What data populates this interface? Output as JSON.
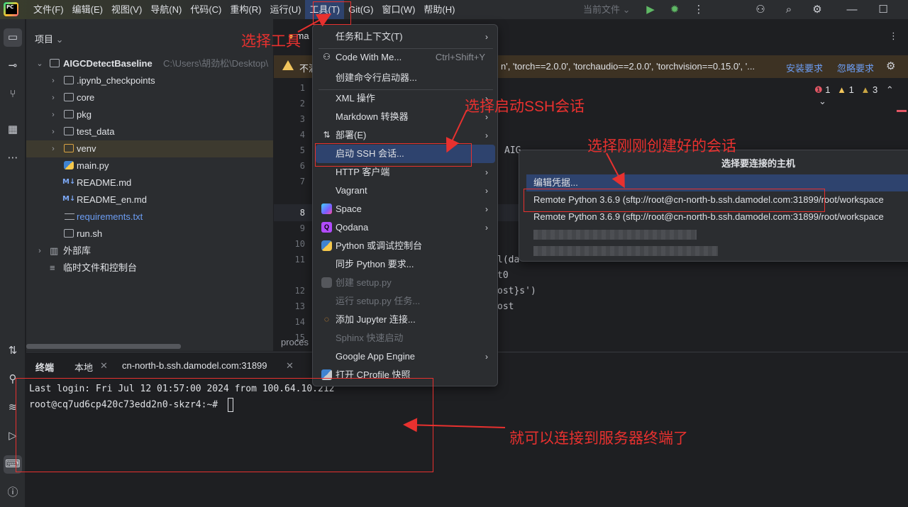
{
  "menubar": {
    "items": [
      {
        "label": "文件(F)"
      },
      {
        "label": "编辑(E)"
      },
      {
        "label": "视图(V)"
      },
      {
        "label": "导航(N)"
      },
      {
        "label": "代码(C)"
      },
      {
        "label": "重构(R)"
      },
      {
        "label": "运行(U)"
      },
      {
        "label": "工具(T)"
      },
      {
        "label": "Git(G)"
      },
      {
        "label": "窗口(W)"
      },
      {
        "label": "帮助(H)"
      }
    ],
    "run_config": "当前文件"
  },
  "project_panel": {
    "title": "项目",
    "root": {
      "name": "AIGCDetectBaseline",
      "path": "C:\\Users\\胡劲松\\Desktop\\"
    },
    "items": [
      {
        "name": ".ipynb_checkpoints",
        "type": "folder"
      },
      {
        "name": "core",
        "type": "folder"
      },
      {
        "name": "pkg",
        "type": "folder"
      },
      {
        "name": "test_data",
        "type": "folder"
      },
      {
        "name": "venv",
        "type": "folder"
      },
      {
        "name": "main.py",
        "type": "python"
      },
      {
        "name": "README.md",
        "type": "markdown"
      },
      {
        "name": "README_en.md",
        "type": "markdown"
      },
      {
        "name": "requirements.txt",
        "type": "text"
      },
      {
        "name": "run.sh",
        "type": "shell"
      }
    ],
    "external_libs": "外部库",
    "scratches": "临时文件和控制台"
  },
  "editor": {
    "tab_partial": "ma",
    "banner": {
      "text_left": "不满",
      "text_right": "n', 'torch==2.0.0', 'torchaudio==2.0.0', 'torchvision==0.15.0', '...",
      "install_link": "安装要求",
      "ignore_link": "忽略要求"
    },
    "inspections": {
      "errors": "1",
      "warnings": "1",
      "weak": "3"
    },
    "line_numbers": [
      "1",
      "2",
      "3",
      "4",
      "5",
      "6",
      "7",
      "8",
      "9",
      "10",
      "11",
      "12",
      "13",
      "14",
      "15"
    ],
    "current_line": "8",
    "code_fragments": {
      "aig": "AIG",
      "l_da": "l(da",
      "t0": "t0",
      "ost_s": "ost}s')",
      "ost": "ost"
    },
    "bottom_partial": "proces"
  },
  "tools_menu": {
    "items": [
      {
        "label": "任务和上下文(T)",
        "submenu": true,
        "icon": "none"
      },
      {
        "label": "Code With Me...",
        "shortcut": "Ctrl+Shift+Y",
        "icon": "person-icon"
      },
      {
        "label": "创建命令行启动器...",
        "icon": "none"
      },
      {
        "label": "XML 操作",
        "submenu": true,
        "icon": "none"
      },
      {
        "label": "Markdown 转换器",
        "submenu": true,
        "icon": "none"
      },
      {
        "label": "部署(E)",
        "submenu": true,
        "icon": "deploy-icon"
      },
      {
        "label": "启动 SSH 会话...",
        "selected": true,
        "icon": "none"
      },
      {
        "label": "HTTP 客户端",
        "submenu": true,
        "icon": "none"
      },
      {
        "label": "Vagrant",
        "submenu": true,
        "icon": "none"
      },
      {
        "label": "Space",
        "submenu": true,
        "icon": "space-icon"
      },
      {
        "label": "Qodana",
        "submenu": true,
        "icon": "qodana-icon"
      },
      {
        "label": "Python 或调试控制台",
        "icon": "python-icon"
      },
      {
        "label": "同步 Python 要求...",
        "icon": "none"
      },
      {
        "label": "创建 setup.py",
        "disabled": true,
        "icon": "python-gray-icon"
      },
      {
        "label": "运行 setup.py 任务...",
        "disabled": true,
        "icon": "none"
      },
      {
        "label": "添加 Jupyter 连接...",
        "icon": "jupyter-icon"
      },
      {
        "label": "Sphinx 快速启动",
        "disabled": true,
        "icon": "none"
      },
      {
        "label": "Google App Engine",
        "submenu": true,
        "icon": "none"
      },
      {
        "label": "打开 CProfile 快照",
        "icon": "cprofile-icon"
      }
    ]
  },
  "host_popup": {
    "title": "选择要连接的主机",
    "edit_label": "编辑凭据...",
    "hosts": [
      {
        "label": "Remote Python 3.6.9 (sftp://root@cn-north-b.ssh.damodel.com:31899/root/workspace"
      },
      {
        "label": "Remote Python 3.6.9 (sftp://root@cn-north-b.ssh.damodel.com:31899/root/workspace"
      }
    ]
  },
  "terminal": {
    "title": "终端",
    "tabs": [
      {
        "label": "本地"
      },
      {
        "label": "cn-north-b.ssh.damodel.com:31899"
      }
    ],
    "lines": [
      "Last login: Fri Jul 12 01:57:00 2024 from 100.64.10.212",
      "root@cq7ud6cp420c73edd2n0-skzr4:~# "
    ]
  },
  "annotations": {
    "select_tools": "选择工具",
    "select_ssh": "选择启动SSH会话",
    "select_session": "选择刚刚创建好的会话",
    "connected": "就可以连接到服务器终端了"
  },
  "colors": {
    "accent": "#2e436e",
    "annotation": "#e8312f",
    "warning": "#f2c55c",
    "link": "#6c9df3"
  }
}
